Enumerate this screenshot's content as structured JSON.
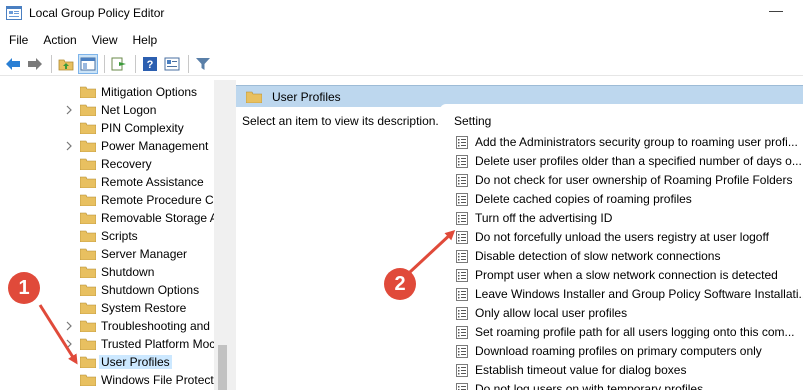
{
  "window": {
    "title": "Local Group Policy Editor"
  },
  "menu": [
    "File",
    "Action",
    "View",
    "Help"
  ],
  "toolbar": [
    "back-icon",
    "forward-icon",
    "up-folder-icon",
    "show-hide-tree-icon",
    "export-list-icon",
    "help-icon",
    "properties-icon",
    "filter-icon"
  ],
  "tree": {
    "items": [
      {
        "label": "Mitigation Options",
        "expandable": false
      },
      {
        "label": "Net Logon",
        "expandable": true
      },
      {
        "label": "PIN Complexity",
        "expandable": false
      },
      {
        "label": "Power Management",
        "expandable": true
      },
      {
        "label": "Recovery",
        "expandable": false
      },
      {
        "label": "Remote Assistance",
        "expandable": false
      },
      {
        "label": "Remote Procedure Ca",
        "expandable": false
      },
      {
        "label": "Removable Storage A",
        "expandable": false
      },
      {
        "label": "Scripts",
        "expandable": false
      },
      {
        "label": "Server Manager",
        "expandable": false
      },
      {
        "label": "Shutdown",
        "expandable": false
      },
      {
        "label": "Shutdown Options",
        "expandable": false
      },
      {
        "label": "System Restore",
        "expandable": false
      },
      {
        "label": "Troubleshooting and",
        "expandable": true
      },
      {
        "label": "Trusted Platform Moc",
        "expandable": true
      },
      {
        "label": "User Profiles",
        "expandable": false,
        "selected": true
      },
      {
        "label": "Windows File Protect",
        "expandable": false
      }
    ]
  },
  "right": {
    "header": "User Profiles",
    "description": "Select an item to view its description.",
    "column_header": "Setting",
    "settings": [
      "Add the Administrators security group to roaming user profi...",
      "Delete user profiles older than a specified number of days o...",
      "Do not check for user ownership of Roaming Profile Folders",
      "Delete cached copies of roaming profiles",
      "Turn off the advertising ID",
      "Do not forcefully unload the users registry at user logoff",
      "Disable detection of slow network connections",
      "Prompt user when a slow network connection is detected",
      "Leave Windows Installer and Group Policy Software Installati...",
      "Only allow local user profiles",
      "Set roaming profile path for all users logging onto this com...",
      "Download roaming profiles on primary computers only",
      "Establish timeout value for dialog boxes",
      "Do not log users on with temporary profiles"
    ]
  },
  "annotations": {
    "badge1": "1",
    "badge2": "2"
  },
  "colors": {
    "selection": "#cce8ff",
    "header_band": "#bdd7ee",
    "annotation": "#e04a3a",
    "folder": "#e8c060"
  }
}
